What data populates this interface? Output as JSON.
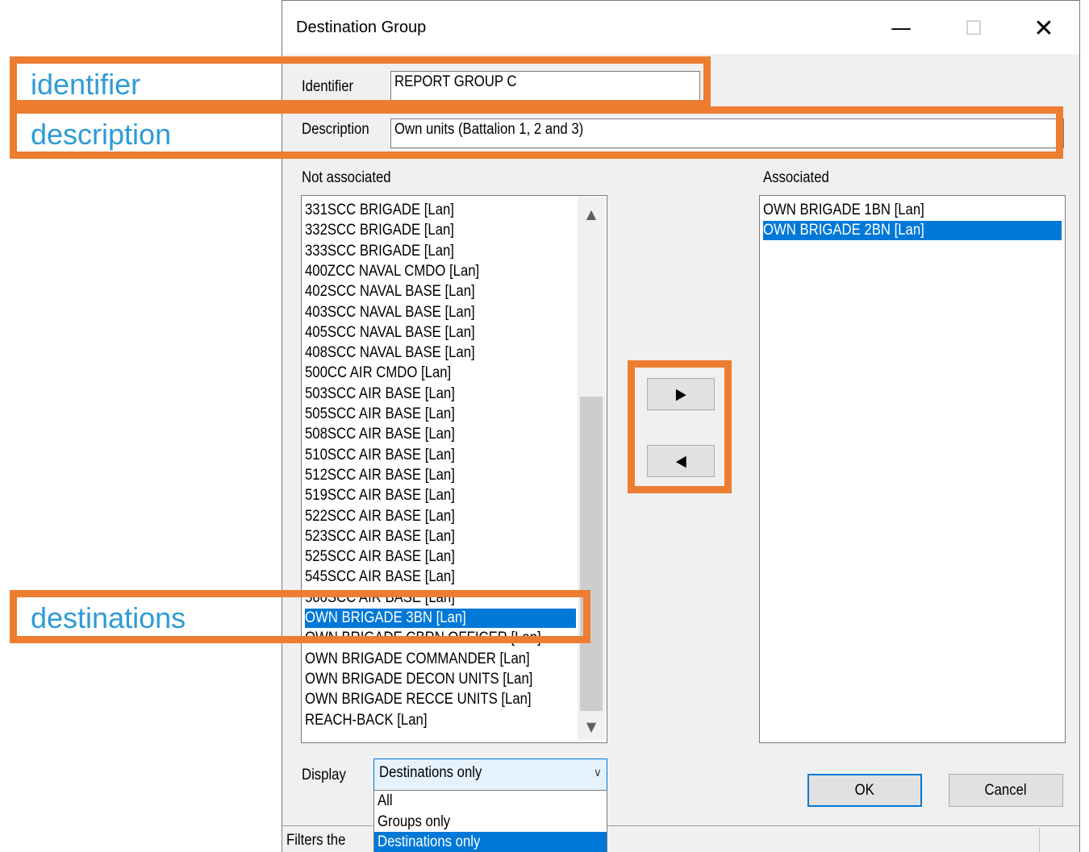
{
  "window": {
    "title": "Destination Group",
    "minimize_glyph": "—",
    "maximize_glyph": "☐",
    "close_glyph": "✕"
  },
  "form": {
    "identifier_label": "Identifier",
    "identifier_value": "REPORT GROUP C",
    "description_label": "Description",
    "description_value": "Own units (Battalion 1, 2 and 3)"
  },
  "not_associated": {
    "label": "Not associated",
    "items": [
      "331SCC BRIGADE [Lan]",
      "332SCC BRIGADE  [Lan]",
      "333SCC BRIGADE [Lan]",
      "400ZCC NAVAL CMDO [Lan]",
      "402SCC NAVAL BASE [Lan]",
      "403SCC NAVAL BASE [Lan]",
      "405SCC NAVAL BASE [Lan]",
      "408SCC NAVAL BASE [Lan]",
      "500CC AIR CMDO [Lan]",
      "503SCC AIR BASE [Lan]",
      "505SCC AIR BASE [Lan]",
      "508SCC AIR BASE [Lan]",
      "510SCC AIR BASE [Lan]",
      "512SCC AIR BASE [Lan]",
      "519SCC AIR BASE [Lan]",
      "522SCC AIR BASE [Lan]",
      "523SCC AIR BASE [Lan]",
      "525SCC AIR BASE [Lan]",
      "545SCC AIR BASE [Lan]",
      "560SCC AIR BASE [Lan]",
      "OWN BRIGADE 3BN [Lan]",
      "OWN BRIGADE CBRN OFFICER [Lan]",
      "OWN BRIGADE COMMANDER [Lan]",
      "OWN BRIGADE DECON UNITS [Lan]",
      "OWN BRIGADE RECCE UNITS [Lan]",
      "REACH-BACK [Lan]"
    ],
    "selected_index": 20,
    "scroll_up_icon": "▲",
    "scroll_down_icon": "▼"
  },
  "associated": {
    "label": "Associated",
    "items": [
      "OWN BRIGADE 1BN [Lan]",
      "OWN BRIGADE 2BN [Lan]"
    ],
    "selected_index": 1
  },
  "transfer": {
    "add_icon": "▶",
    "remove_icon": "◀"
  },
  "display": {
    "label": "Display",
    "value": "Destinations only",
    "arrow_icon": "∨",
    "options": [
      "All",
      "Groups only",
      "Destinations only"
    ],
    "selected_index": 2
  },
  "buttons": {
    "ok": "OK",
    "cancel": "Cancel"
  },
  "status": {
    "text": "Filters the"
  },
  "callouts": {
    "identifier": "identifier",
    "description": "description",
    "destinations": "destinations",
    "color": "#ed7d31",
    "text_color": "#2e9bd6"
  }
}
